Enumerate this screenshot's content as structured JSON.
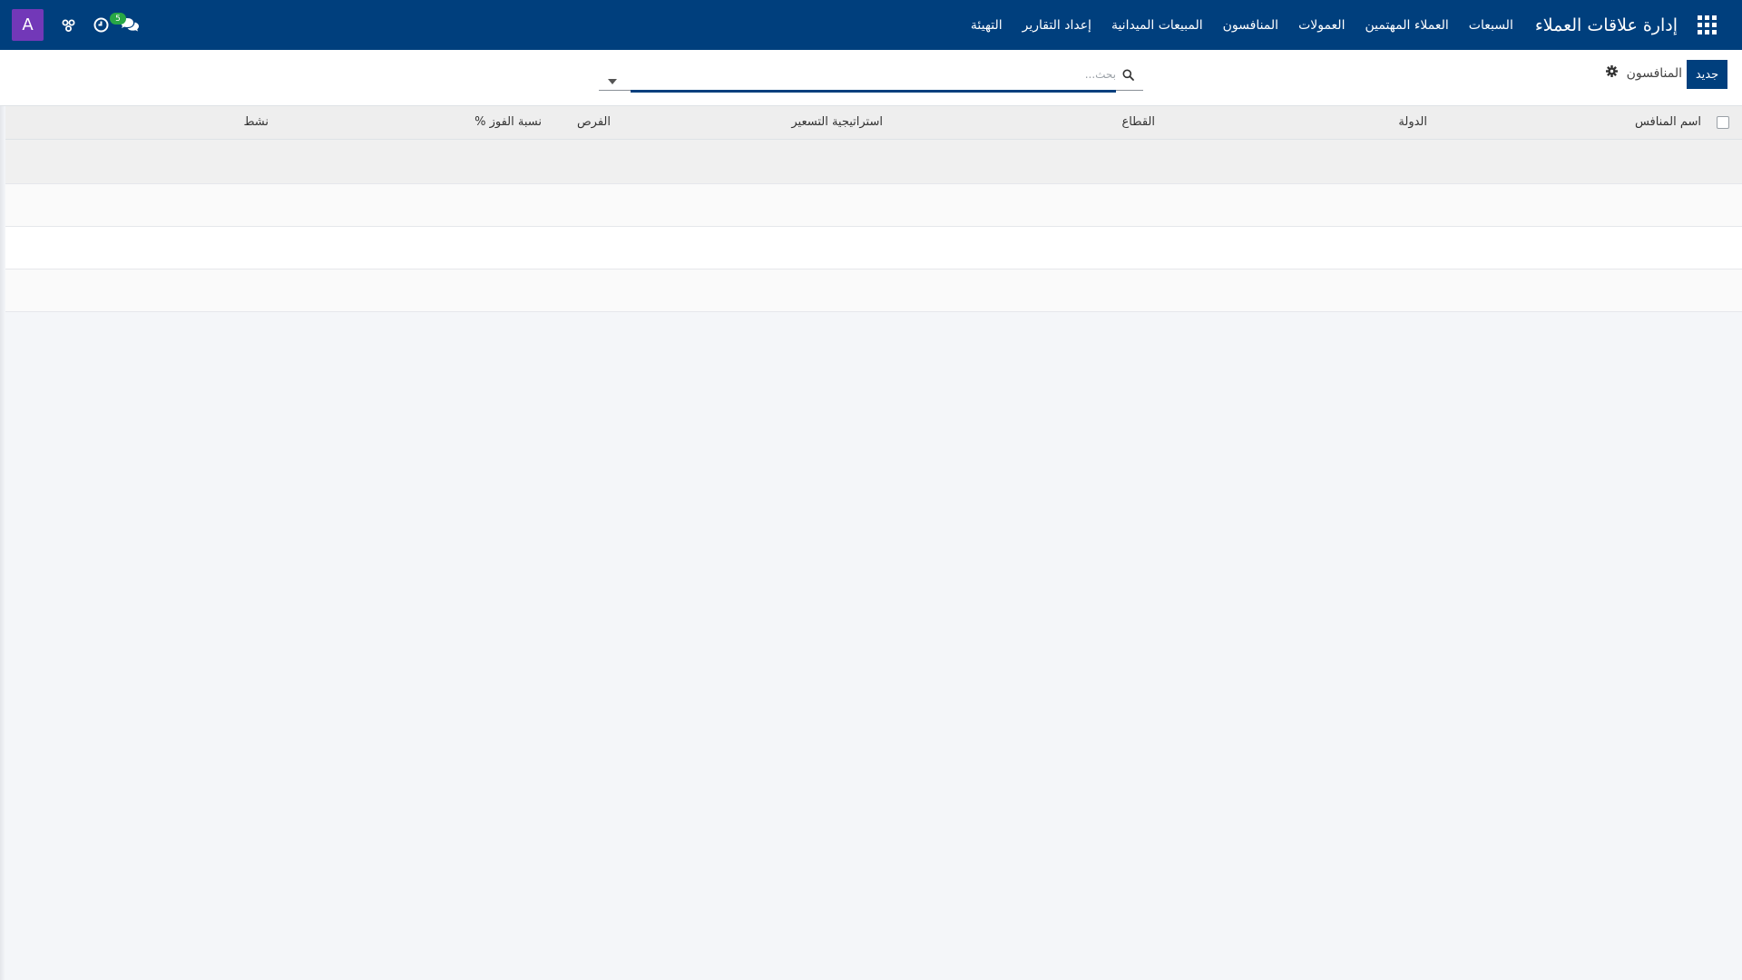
{
  "navbar": {
    "brand": "إدارة علاقات العملاء",
    "menu": [
      "السبعات",
      "العملاء المهتمين",
      "العمولات",
      "المنافسون",
      "المبيعات الميدانية",
      "إعداد التقارير",
      "التهيئة"
    ],
    "chat_count": "5",
    "avatar_letter": "A",
    "colors": {
      "navbar": "#003f7d",
      "avatar": "#7238b8",
      "badge": "#28a745"
    }
  },
  "control": {
    "new_button": "جديد",
    "breadcrumb": "المنافسون",
    "search_placeholder": "بحث..."
  },
  "table": {
    "columns": [
      "اسم المنافس",
      "الدولة",
      "القطاع",
      "استراتيجية التسعير",
      "الفرص",
      "نسبة الفوز %",
      "نشط"
    ],
    "rows": [
      [],
      [],
      [],
      []
    ]
  }
}
